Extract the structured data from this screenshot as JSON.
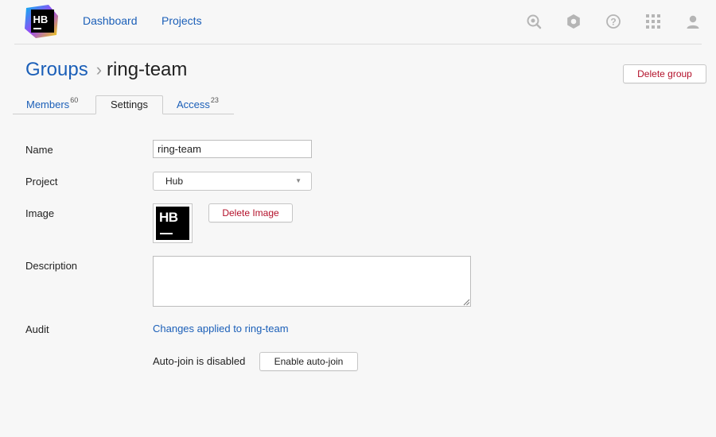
{
  "header": {
    "logo_text": "HB",
    "nav": [
      {
        "label": "Dashboard"
      },
      {
        "label": "Projects"
      }
    ],
    "icons": [
      "search-icon",
      "settings-icon",
      "help-icon",
      "apps-grid-icon",
      "user-icon"
    ]
  },
  "breadcrumb": {
    "parent": "Groups",
    "separator": "›",
    "current": "ring-team"
  },
  "actions": {
    "delete_group": "Delete group"
  },
  "tabs": [
    {
      "label": "Members",
      "count": "60"
    },
    {
      "label": "Settings",
      "count": ""
    },
    {
      "label": "Access",
      "count": "23"
    }
  ],
  "form": {
    "name": {
      "label": "Name",
      "value": "ring-team"
    },
    "project": {
      "label": "Project",
      "value": "Hub"
    },
    "image": {
      "label": "Image",
      "thumb_text": "HB",
      "delete_label": "Delete Image"
    },
    "description": {
      "label": "Description",
      "value": ""
    },
    "audit": {
      "label": "Audit",
      "link": "Changes applied to ring-team"
    },
    "autojoin": {
      "status": "Auto-join is disabled",
      "button": "Enable auto-join"
    }
  },
  "colors": {
    "link": "#1b5fb8",
    "danger": "#b3102a",
    "background": "#f7f7f7"
  }
}
